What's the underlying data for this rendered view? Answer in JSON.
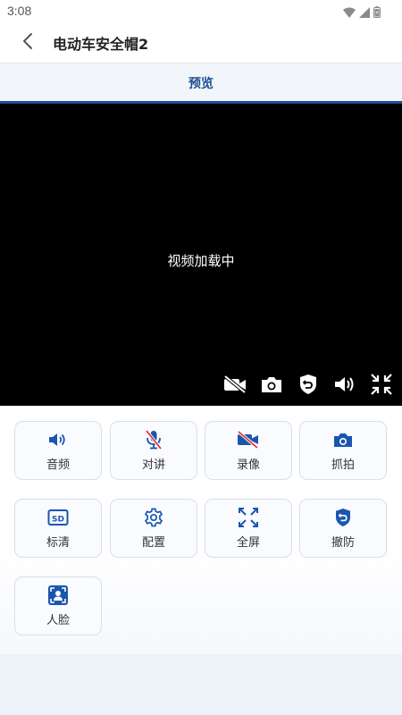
{
  "status_bar": {
    "time": "3:08"
  },
  "header": {
    "title": "电动车安全帽2"
  },
  "tabs": [
    {
      "label": "预览"
    }
  ],
  "video": {
    "status_text": "视频加载中"
  },
  "functions": [
    {
      "label": "音频",
      "icon": "speaker-icon"
    },
    {
      "label": "对讲",
      "icon": "mic-off-icon"
    },
    {
      "label": "录像",
      "icon": "video-off-icon"
    },
    {
      "label": "抓拍",
      "icon": "camera-icon"
    },
    {
      "label": "标清",
      "icon": "sd-icon"
    },
    {
      "label": "配置",
      "icon": "gear-icon"
    },
    {
      "label": "全屏",
      "icon": "fullscreen-icon"
    },
    {
      "label": "撤防",
      "icon": "disarm-shield-icon"
    },
    {
      "label": "人脸",
      "icon": "face-icon"
    }
  ],
  "colors": {
    "accent": "#1d4f95",
    "icon_blue": "#1a56b0",
    "icon_red": "#e0343c"
  }
}
